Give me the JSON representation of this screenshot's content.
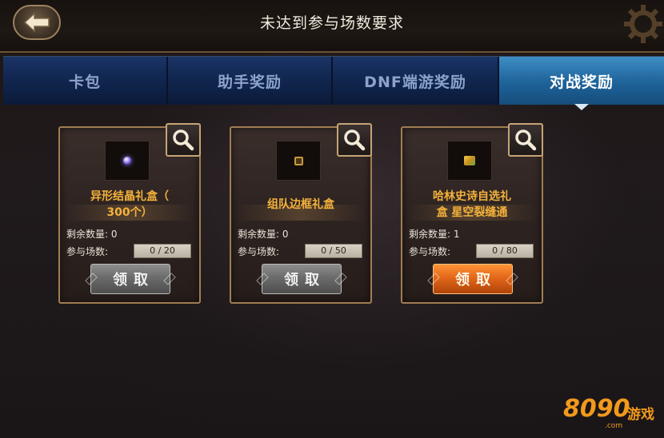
{
  "header": {
    "title": "未达到参与场数要求"
  },
  "tabs": [
    {
      "label": "卡包",
      "active": false
    },
    {
      "label": "助手奖励",
      "active": false
    },
    {
      "label": "DNF端游奖励",
      "active": false
    },
    {
      "label": "对战奖励",
      "active": true
    }
  ],
  "cards": [
    {
      "name": "异形结晶礼盒（300个）",
      "name_line1": "异形结晶礼盒（",
      "name_line2": "300个）",
      "remaining_label": "剩余数量:",
      "remaining_value": "0",
      "matches_label": "参与场数:",
      "matches_progress": "0 / 20",
      "claim_label": "领取",
      "claim_enabled": false,
      "icon": "gem-icon"
    },
    {
      "name": "组队边框礼盒",
      "name_line1": "组队边框礼盒",
      "name_line2": "",
      "remaining_label": "剩余数量:",
      "remaining_value": "0",
      "matches_label": "参与场数:",
      "matches_progress": "0 / 50",
      "claim_label": "领取",
      "claim_enabled": false,
      "icon": "frame-icon"
    },
    {
      "name": "哈林史诗自选礼盒 星空裂缝通",
      "name_line1": "哈林史诗自选礼",
      "name_line2": "盒 星空裂缝通",
      "remaining_label": "剩余数量:",
      "remaining_value": "1",
      "matches_label": "参与场数:",
      "matches_progress": "0 / 80",
      "claim_label": "领取",
      "claim_enabled": true,
      "icon": "chest-icon"
    }
  ],
  "watermark": {
    "number": "8090",
    "text": "游戏",
    "domain": ".com"
  },
  "colors": {
    "item_name": "#f4b23a",
    "tab_active": "#1e6299",
    "tab_inactive": "#10244c",
    "claim_active": "#e2671a",
    "claim_disabled": "#6b6b6b",
    "card_border": "#a07d52"
  }
}
